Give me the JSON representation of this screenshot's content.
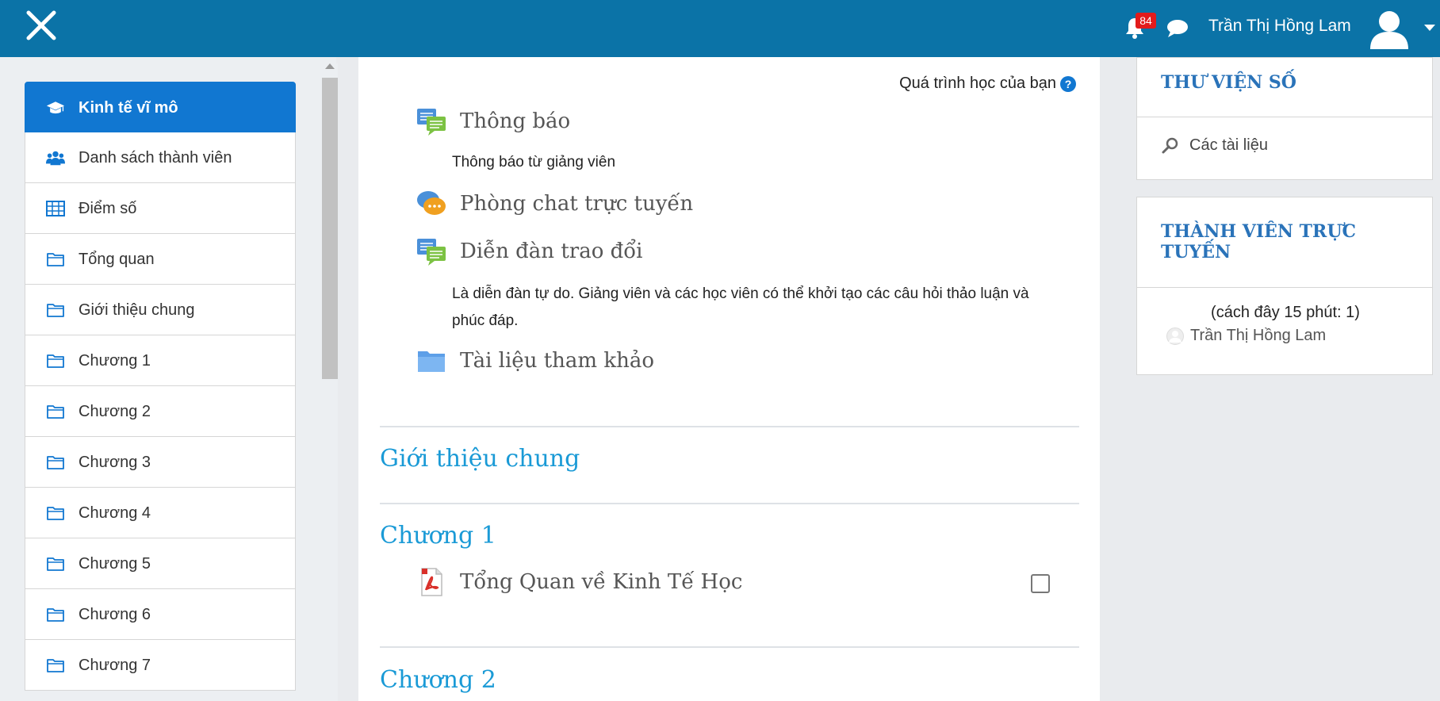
{
  "header": {
    "notification_count": "84",
    "user_name": "Trần Thị Hồng Lam",
    "brand_color": "#0b73a7"
  },
  "drawer": {
    "items": [
      {
        "label": "Kinh tế vĩ mô",
        "icon": "graduation-cap-icon",
        "active": true
      },
      {
        "label": "Danh sách thành viên",
        "icon": "users-icon"
      },
      {
        "label": "Điểm số",
        "icon": "table-icon"
      },
      {
        "label": "Tổng quan",
        "icon": "folder-icon"
      },
      {
        "label": "Giới thiệu chung",
        "icon": "folder-icon"
      },
      {
        "label": "Chương 1",
        "icon": "folder-icon"
      },
      {
        "label": "Chương 2",
        "icon": "folder-icon"
      },
      {
        "label": "Chương 3",
        "icon": "folder-icon"
      },
      {
        "label": "Chương 4",
        "icon": "folder-icon"
      },
      {
        "label": "Chương 5",
        "icon": "folder-icon"
      },
      {
        "label": "Chương 6",
        "icon": "folder-icon"
      },
      {
        "label": "Chương 7",
        "icon": "folder-icon"
      }
    ]
  },
  "main": {
    "progress_label": "Quá trình học của bạn",
    "activities": [
      {
        "name": "Thông báo",
        "icon": "forum-icon",
        "description": "Thông báo từ giảng viên"
      },
      {
        "name": "Phòng chat trực tuyến",
        "icon": "chat-room-icon"
      },
      {
        "name": "Diễn đàn trao đổi",
        "icon": "forum-icon",
        "description": "Là diễn đàn tự do. Giảng viên và các học viên có thể khởi tạo các câu hỏi thảo luận và phúc đáp."
      },
      {
        "name": "Tài liệu tham khảo",
        "icon": "folder-icon"
      }
    ],
    "sections": [
      {
        "title": "Giới thiệu chung"
      },
      {
        "title": "Chương 1",
        "activities": [
          {
            "name": "Tổng Quan về Kinh Tế Học",
            "icon": "pdf-icon",
            "completed": false
          }
        ]
      },
      {
        "title": "Chương 2"
      }
    ]
  },
  "blocks": {
    "library": {
      "title": "THƯ VIỆN SỐ",
      "link": "Các tài liệu"
    },
    "online_users": {
      "title": "THÀNH VIÊN TRỰC TUYẾN",
      "note": "(cách đây 15 phút: 1)",
      "users": [
        "Trần Thị Hồng Lam"
      ]
    }
  }
}
